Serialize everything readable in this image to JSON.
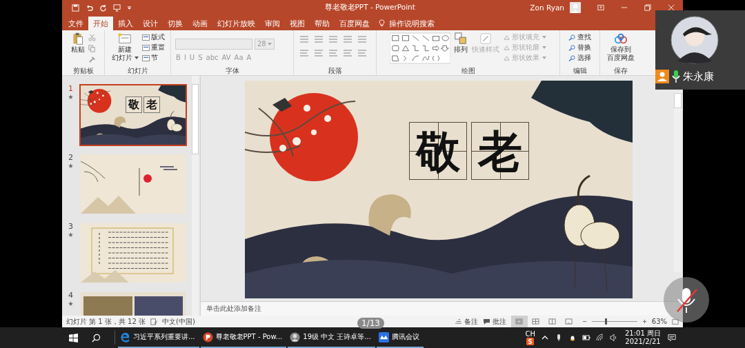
{
  "window": {
    "title": "尊老敬老PPT - PowerPoint",
    "user": "Zon Ryan"
  },
  "tabs": [
    {
      "label": "文件",
      "selected": false
    },
    {
      "label": "开始",
      "selected": true
    },
    {
      "label": "插入",
      "selected": false
    },
    {
      "label": "设计",
      "selected": false
    },
    {
      "label": "切换",
      "selected": false
    },
    {
      "label": "动画",
      "selected": false
    },
    {
      "label": "幻灯片放映",
      "selected": false
    },
    {
      "label": "审阅",
      "selected": false
    },
    {
      "label": "视图",
      "selected": false
    },
    {
      "label": "帮助",
      "selected": false
    },
    {
      "label": "百度网盘",
      "selected": false
    }
  ],
  "tell_me": "操作说明搜索",
  "ribbon": {
    "clipboard": {
      "title": "剪贴板",
      "paste": "粘贴"
    },
    "slides": {
      "title": "幻灯片",
      "new_slide": [
        "新建",
        "幻灯片"
      ],
      "items": [
        {
          "label": "版式"
        },
        {
          "label": "重置"
        },
        {
          "label": "节"
        }
      ]
    },
    "font": {
      "title": "字体",
      "size": "28",
      "disabled": true,
      "buttons": [
        "B",
        "I",
        "U",
        "S",
        "abc",
        "AV",
        "Aa",
        "A"
      ]
    },
    "paragraph": {
      "title": "段落"
    },
    "drawing": {
      "title": "绘图",
      "arrange": "排列",
      "quick_styles": {
        "label": "快速样式",
        "disabled": true
      },
      "shape_items": [
        {
          "label": "形状填充",
          "disabled": true
        },
        {
          "label": "形状轮廓",
          "disabled": true
        },
        {
          "label": "形状效果",
          "disabled": true
        }
      ]
    },
    "editing": {
      "title": "编辑",
      "items": [
        {
          "label": "查找"
        },
        {
          "label": "替换"
        },
        {
          "label": "选择"
        }
      ]
    },
    "save": {
      "title": "保存",
      "button": [
        "保存到",
        "百度网盘"
      ]
    }
  },
  "slides": [
    {
      "number": "1",
      "selected": true,
      "kind": "title",
      "title": [
        "敬",
        "老"
      ]
    },
    {
      "number": "2",
      "selected": false,
      "kind": "ink"
    },
    {
      "number": "3",
      "selected": false,
      "kind": "poem"
    },
    {
      "number": "4",
      "selected": false,
      "kind": "photos"
    }
  ],
  "main_slide": {
    "title": [
      "敬",
      "老"
    ]
  },
  "notes_placeholder": "单击此处添加备注",
  "status_bar": {
    "slide_info": "幻灯片 第 1 张，共 12 张",
    "language": "中文(中国)",
    "notes": "备注",
    "comments": "批注",
    "views": [
      {
        "selected": true
      },
      {
        "selected": false
      },
      {
        "selected": false
      },
      {
        "selected": false
      }
    ],
    "zoom": {
      "level": 0.3
    },
    "zoom_text": "63%"
  },
  "page_indicator": "1/13",
  "meeting": {
    "name": "朱永康"
  },
  "taskbar": {
    "items": [
      {
        "kind": "edge",
        "label": "习近平系列重要讲..."
      },
      {
        "kind": "powerpoint",
        "label": "尊老敬老PPT - Pow..."
      },
      {
        "kind": "avatar",
        "label": "19级 中文 王诗卓等..."
      },
      {
        "kind": "meeting",
        "label": "腾讯会议"
      }
    ],
    "ime": "CH",
    "time": "21:01 周日",
    "date": "2021/2/21"
  }
}
